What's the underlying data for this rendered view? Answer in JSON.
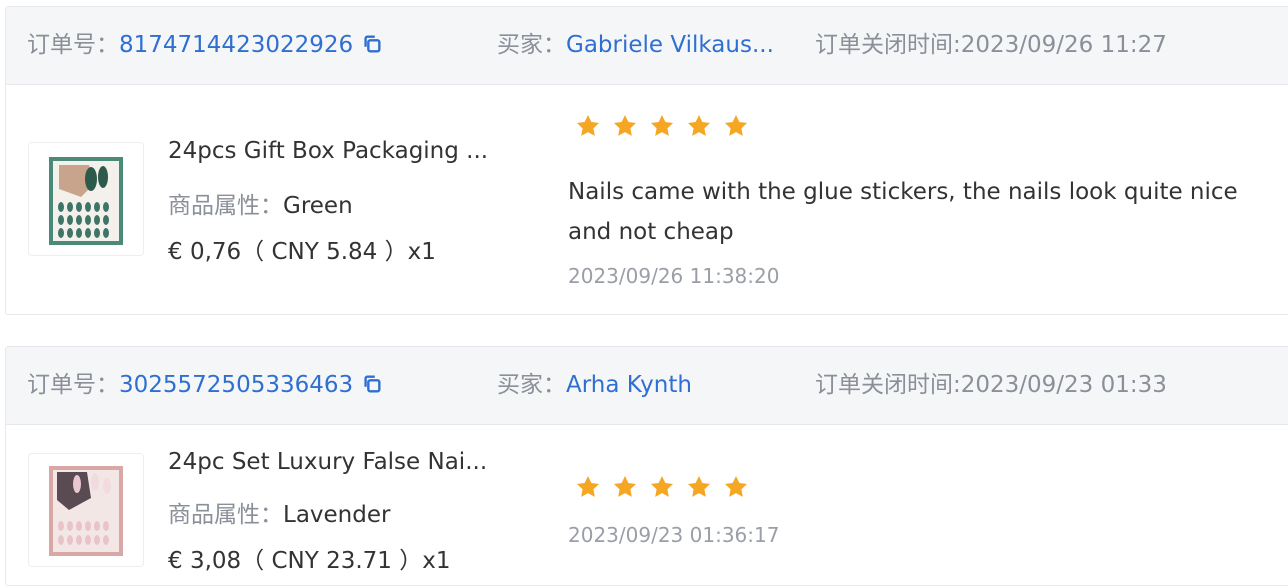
{
  "colors": {
    "link": "#2f6fd1",
    "label": "#8a8f99",
    "star": "#f5a623"
  },
  "orders": [
    {
      "order_label": "订单号：",
      "order_no": "8174714423022926",
      "buyer_label": "买家：",
      "buyer_name": "Gabriele Vilkaus...",
      "closed_label": "订单关闭时间:",
      "closed_time": "2023/09/26 11:27",
      "product": {
        "title": "24pcs Gift Box Packaging ...",
        "attr_label": "商品属性：",
        "attr_value": "Green",
        "price": "€ 0,76（ CNY  5.84 ）x1",
        "thumb_color": "#4b8a78"
      },
      "rating": 5,
      "review_text": "Nails came with the glue stickers, the nails look quite nice and not cheap",
      "review_time": "2023/09/26 11:38:20"
    },
    {
      "order_label": "订单号：",
      "order_no": "3025572505336463",
      "buyer_label": "买家：",
      "buyer_name": "Arha Kynth",
      "closed_label": "订单关闭时间:",
      "closed_time": "2023/09/23 01:33",
      "product": {
        "title": "24pc Set Luxury False Nai...",
        "attr_label": "商品属性：",
        "attr_value": "Lavender",
        "price": "€ 3,08（ CNY  23.71 ）x1",
        "thumb_color": "#d9a7a5"
      },
      "rating": 5,
      "review_text": "",
      "review_time": "2023/09/23 01:36:17"
    }
  ]
}
